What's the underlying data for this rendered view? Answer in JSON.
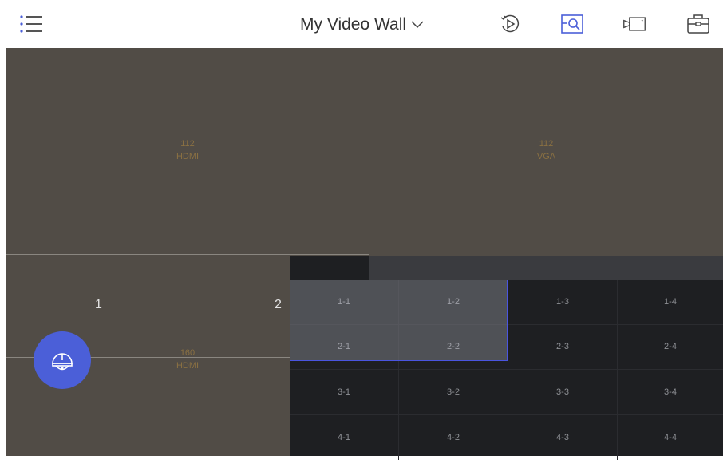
{
  "header": {
    "title": "My Video Wall",
    "icons": [
      "menu-icon",
      "chevron-down-icon",
      "playback-icon",
      "search-window-icon",
      "camera-icon",
      "toolbox-icon"
    ]
  },
  "wall": {
    "screens": [
      {
        "id": "112",
        "source": "HDMI"
      },
      {
        "id": "112",
        "source": "VGA"
      },
      {
        "id": "160",
        "source": "HDMI"
      }
    ],
    "window_numbers": [
      "1",
      "2"
    ]
  },
  "picker": {
    "rows": [
      [
        "1-1",
        "1-2",
        "1-3",
        "1-4"
      ],
      [
        "2-1",
        "2-2",
        "2-3",
        "2-4"
      ],
      [
        "3-1",
        "3-2",
        "3-3",
        "3-4"
      ],
      [
        "4-1",
        "4-2",
        "4-3",
        "4-4"
      ]
    ],
    "selected": [
      "1-1",
      "1-2",
      "2-1",
      "2-2"
    ]
  },
  "colors": {
    "accent": "#4b5fd8",
    "wall": "#514c46",
    "label": "#8a7042"
  }
}
